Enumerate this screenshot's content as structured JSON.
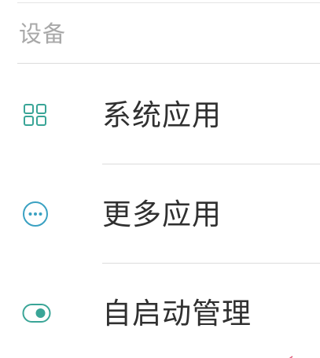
{
  "section": {
    "title": "设备"
  },
  "items": [
    {
      "label": "系统应用",
      "icon": "grid-icon"
    },
    {
      "label": "更多应用",
      "icon": "more-circle-icon"
    },
    {
      "label": "自启动管理",
      "icon": "toggle-icon"
    }
  ],
  "colors": {
    "accent": "#3aa597",
    "label": "#303030",
    "header": "#a8a8a8",
    "divider": "#dcdcdc"
  }
}
